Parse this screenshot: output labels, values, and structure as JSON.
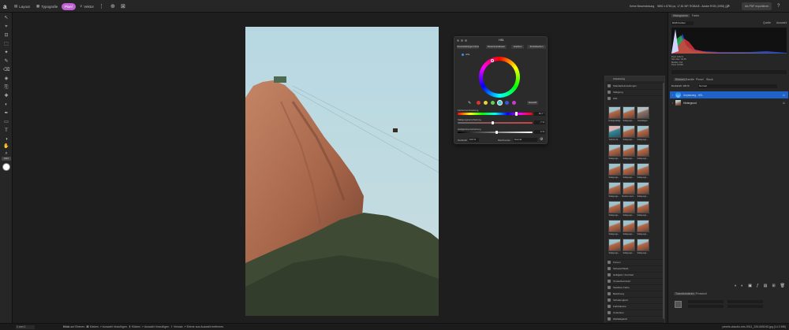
{
  "topbar": {
    "persona_layout": "Layout",
    "persona_typo": "Typografie",
    "persona_pixel": "Pixel",
    "persona_vector": "Vektor",
    "doc_info": "5892 x 8784 px, 17,81 MP, RGBA/8 - Adobe RGB (1998) (Z...",
    "doc_title": "Keine Beschränkung",
    "export_button": "Als PDF exportieren"
  },
  "tool_label": "GRA",
  "status": {
    "zoom": "1 von 1",
    "hint_bold1": "Klick",
    "hint_text1": "auf Ebenen.",
    "hint_bold2": "⌘",
    "hint_text2": "Klicken ↗ Auswahl hinzufügen.",
    "hint_bold3": "⇧",
    "hint_text3": "Klicken ↗ Auswahl hinzufügen. ⇧ Versatz ↗ Ebene aus Auswahl entfernen.",
    "filename": "pexels-claudio-reis-9311_226-845240.jpg (14.3 MB)"
  },
  "hsl_dialog": {
    "title": "HSL",
    "tabs": [
      "Voreinstellungen hinzufügen",
      "Zusammenfassen",
      "Löschen",
      "Zurücksetzen"
    ],
    "hsl_label": "HSL",
    "reset_button": "Auswahl",
    "hue_label": "Farbtonverschiebung",
    "hue_value": "36,7 °",
    "sat_label": "Sättigungsverschiebung",
    "sat_value": "-7 %",
    "light_label": "Helligkeitsverschiebung",
    "light_value": "6 %",
    "opacity_label": "Deckkraft",
    "opacity_value": "100 %",
    "blend_label": "Mischmodus",
    "blend_value": "Normal"
  },
  "adjustments": {
    "title": "Anpassung",
    "preset1": "Standardeinstellungen",
    "preset_label1": "Sättigung",
    "thumbs": [
      "Unabgesättigt",
      "Sättigungs...",
      "Entsättigen",
      "Farbton fü...",
      "Sättigungs...",
      "Sättigungs...",
      "Sättigungs...",
      "Sättigungs...",
      "Sättigungs...",
      "Sättigungs...",
      "Sättigungs...",
      "Sättigungs...",
      "Sättigungs...",
      "Dunkler werd...",
      "Sättigungs...",
      "Sättigungs...",
      "Sättigungs...",
      "Sättigungs...",
      "Sättigungs...",
      "Sättigungs...",
      "Sättigungs...",
      "Sättigungs...",
      "Sättigungs...",
      "Sättigungs..."
    ],
    "list": [
      "Kurven",
      "Schwarz/Weiß",
      "Helligkeit / Kontrast",
      "Tonwertkorrektur",
      "Selektive Farbe",
      "Belichtung",
      "Schattenglanz",
      "Farbbalance",
      "Umkehren",
      "Weißabgleich",
      "Schatten/Lichter"
    ]
  },
  "right": {
    "tabs_top": [
      "Histogramm",
      "Farbe"
    ],
    "histo_select": "RGB Farben",
    "histo_btn1": "Quelle",
    "histo_btn2": "Auswahl",
    "stats": [
      "Pixel: 108,73",
      "Std. Abw.: 82,55",
      "Median: 114",
      "Pixel: 51'000"
    ],
    "layer_tabs": [
      "Ebenen",
      "Kanäle",
      "Pinsel",
      "Stock"
    ],
    "opacity": "Deckkraft: 100 %",
    "blend": "Normal",
    "layers": [
      "Anpassung - HSL",
      "Hintergrund"
    ],
    "bottom_tabs": [
      "Transformieren",
      "Protokoll"
    ]
  }
}
